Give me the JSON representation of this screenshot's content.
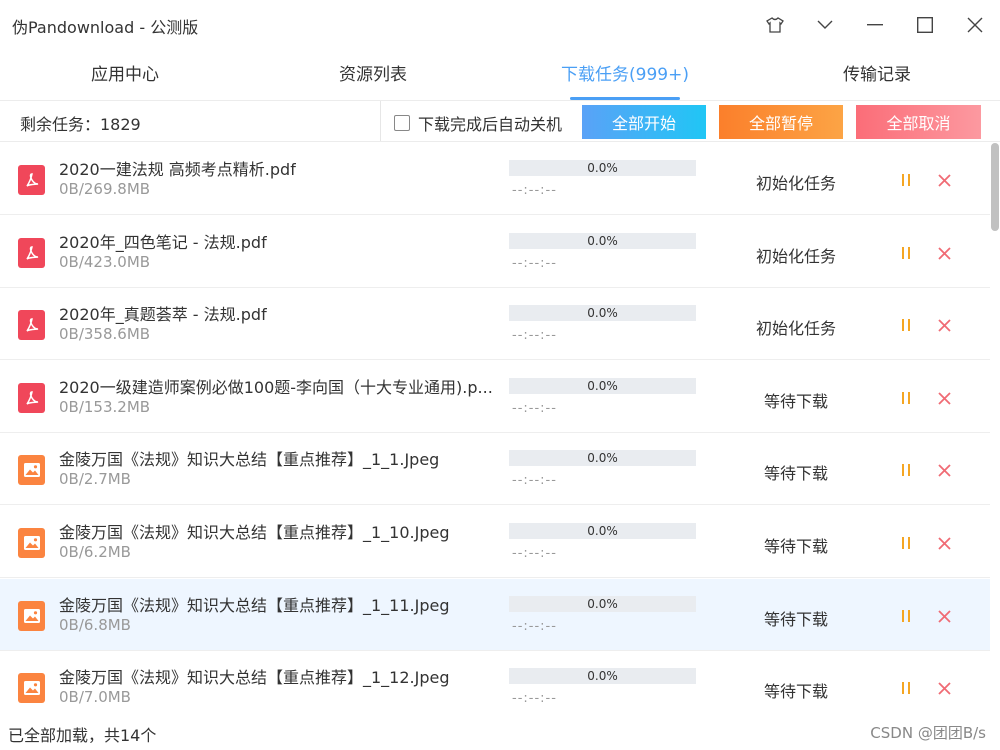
{
  "window": {
    "title": "伪Pandownload - 公测版"
  },
  "tabs": [
    {
      "label": "应用中心"
    },
    {
      "label": "资源列表"
    },
    {
      "label": "下载任务(999+)"
    },
    {
      "label": "传输记录"
    }
  ],
  "toolbar": {
    "remaining": "剩余任务：1829",
    "shutdown_label": "下载完成后自动关机",
    "start_all": "全部开始",
    "pause_all": "全部暂停",
    "cancel_all": "全部取消"
  },
  "tasks": [
    {
      "icon": "pdf-file-icon",
      "name": "2020一建法规 高频考点精析.pdf",
      "size": "0B/269.8MB",
      "progress_text": "0.0%",
      "progress": 0,
      "eta": "--:--:--",
      "status": "初始化任务"
    },
    {
      "icon": "pdf-file-icon",
      "name": "2020年_四色笔记 - 法规.pdf",
      "size": "0B/423.0MB",
      "progress_text": "0.0%",
      "progress": 0,
      "eta": "--:--:--",
      "status": "初始化任务"
    },
    {
      "icon": "pdf-file-icon",
      "name": "2020年_真题荟萃 - 法规.pdf",
      "size": "0B/358.6MB",
      "progress_text": "0.0%",
      "progress": 0,
      "eta": "--:--:--",
      "status": "初始化任务"
    },
    {
      "icon": "pdf-file-icon",
      "name": "2020一级建造师案例必做100题-李向国（十大专业通用).p...",
      "size": "0B/153.2MB",
      "progress_text": "0.0%",
      "progress": 0,
      "eta": "--:--:--",
      "status": "等待下载"
    },
    {
      "icon": "image-file-icon",
      "name": "金陵万国《法规》知识大总结【重点推荐】_1_1.Jpeg",
      "size": "0B/2.7MB",
      "progress_text": "0.0%",
      "progress": 0,
      "eta": "--:--:--",
      "status": "等待下载"
    },
    {
      "icon": "image-file-icon",
      "name": "金陵万国《法规》知识大总结【重点推荐】_1_10.Jpeg",
      "size": "0B/6.2MB",
      "progress_text": "0.0%",
      "progress": 0,
      "eta": "--:--:--",
      "status": "等待下载"
    },
    {
      "icon": "image-file-icon",
      "name": "金陵万国《法规》知识大总结【重点推荐】_1_11.Jpeg",
      "size": "0B/6.8MB",
      "progress_text": "0.0%",
      "progress": 0,
      "eta": "--:--:--",
      "status": "等待下载"
    },
    {
      "icon": "image-file-icon",
      "name": "金陵万国《法规》知识大总结【重点推荐】_1_12.Jpeg",
      "size": "0B/7.0MB",
      "progress_text": "0.0%",
      "progress": 0,
      "eta": "--:--:--",
      "status": "等待下载"
    }
  ],
  "footer": {
    "status": "已全部加载，共14个",
    "speed": "CSDN @团团B/s"
  },
  "colors": {
    "accent": "#4a9ff5",
    "pause_icon": "#f5a623",
    "close_icon": "#f06b74"
  }
}
